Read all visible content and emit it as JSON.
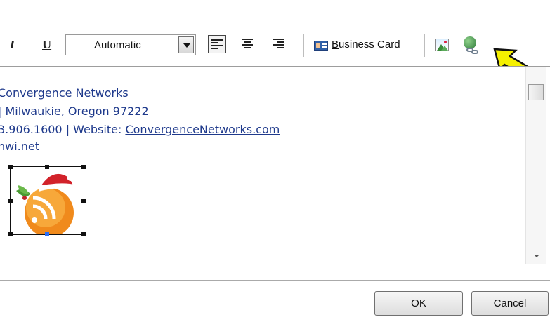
{
  "toolbar": {
    "italic_label": "I",
    "underline_label": "U",
    "font_color_value": "Automatic",
    "business_card_label": "Business Card",
    "business_card_mnemonic": "B",
    "business_card_rest": "usiness Card",
    "icons": [
      "italic-icon",
      "underline-icon",
      "align-left-icon",
      "align-center-icon",
      "align-right-icon",
      "business-card-icon",
      "insert-picture-icon",
      "insert-hyperlink-icon"
    ]
  },
  "editor": {
    "lines": [
      "Convergence Networks",
      "| Milwaukie, Oregon 97222",
      "3.906.1600 | Website: ",
      "nwi.net"
    ],
    "website_link": "ConvergenceNetworks.com",
    "link_color": "#1f3a8c",
    "image": "rss-feed-santa-hat-icon"
  },
  "buttons": {
    "ok": "OK",
    "cancel": "Cancel"
  },
  "annotation": {
    "arrow_color": "#f5f000",
    "points_to": "insert-hyperlink-icon"
  }
}
